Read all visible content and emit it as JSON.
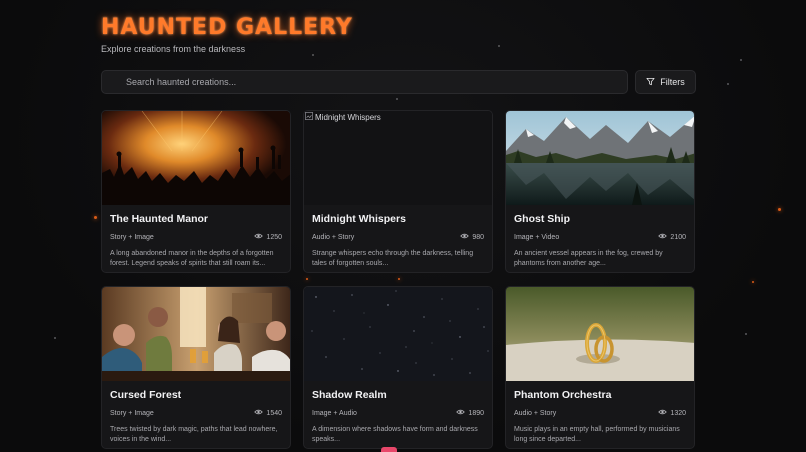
{
  "header": {
    "title": "HAUNTED GALLERY",
    "subtitle": "Explore creations from the darkness"
  },
  "search": {
    "placeholder": "Search haunted creations..."
  },
  "toolbar": {
    "filters_label": "Filters"
  },
  "cards": [
    {
      "title": "The Haunted Manor",
      "type": "Story + Image",
      "views": "1250",
      "description": "A long abandoned manor in the depths of a forgotten forest. Legend speaks of spirits that still roam its...",
      "image": "concert-crowd"
    },
    {
      "title": "Midnight Whispers",
      "type": "Audio + Story",
      "views": "980",
      "description": "Strange whispers echo through the darkness, telling tales of forgotten souls...",
      "image_alt": "Midnight Whispers"
    },
    {
      "title": "Ghost Ship",
      "type": "Image + Video",
      "views": "2100",
      "description": "An ancient vessel appears in the fog, crewed by phantoms from another age...",
      "image": "mountain-lake"
    },
    {
      "title": "Cursed Forest",
      "type": "Story + Image",
      "views": "1540",
      "description": "Trees twisted by dark magic, paths that lead nowhere, voices in the wind...",
      "image": "bar-friends"
    },
    {
      "title": "Shadow Realm",
      "type": "Image + Audio",
      "views": "1890",
      "description": "A dimension where shadows have form and darkness speaks...",
      "image": "starry-sky"
    },
    {
      "title": "Phantom Orchestra",
      "type": "Audio + Story",
      "views": "1320",
      "description": "Music plays in an empty hall, performed by musicians long since departed...",
      "image": "gold-rings"
    }
  ],
  "colors": {
    "accent": "#ff7a2a",
    "background": "#0b0b0c",
    "card": "#161618"
  }
}
